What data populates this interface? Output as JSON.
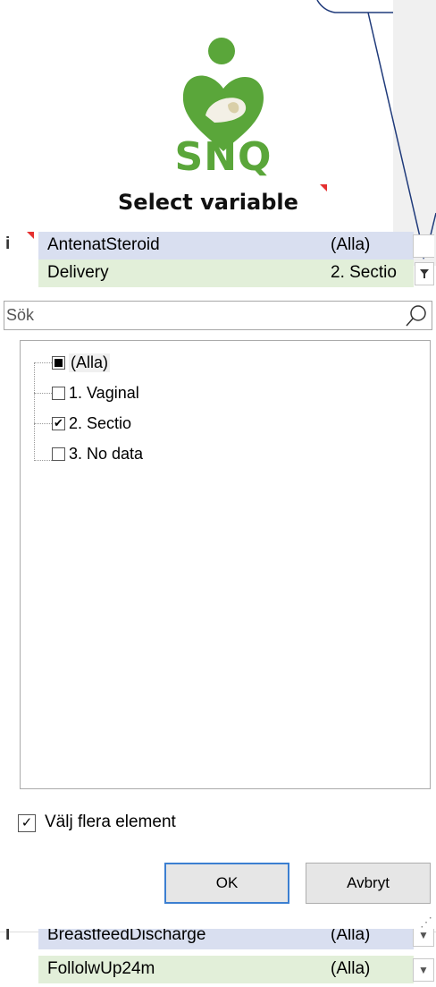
{
  "logo": {
    "text": "SNQ",
    "alt": "snq-logo"
  },
  "title": "Select variable",
  "rows": [
    {
      "marker": "i",
      "name": "AntenatSteroid",
      "value": "(Alla)"
    },
    {
      "marker": "",
      "name": "Delivery",
      "value": "2. Sectio"
    }
  ],
  "search": {
    "placeholder": "Sök"
  },
  "items": [
    {
      "label": "(Alla)",
      "state": "partial"
    },
    {
      "label": "1. Vaginal",
      "state": "unchecked"
    },
    {
      "label": "2. Sectio",
      "state": "checked"
    },
    {
      "label": "3. No data",
      "state": "unchecked"
    }
  ],
  "multi_select": {
    "label": "Välj flera element",
    "checked": true
  },
  "buttons": {
    "ok": "OK",
    "cancel": "Avbryt"
  },
  "bottom_rows": [
    {
      "marker": "I",
      "name": "BreastfeedDischarge",
      "value": "(Alla)"
    },
    {
      "marker": "",
      "name": "FollolwUp24m",
      "value": "(Alla)"
    }
  ],
  "colors": {
    "brand_green": "#5aa63a",
    "row_blue": "#d9dff0",
    "row_green": "#e2efd9",
    "annotation_navy": "#1f3a7a",
    "comment_red": "#e53030"
  }
}
